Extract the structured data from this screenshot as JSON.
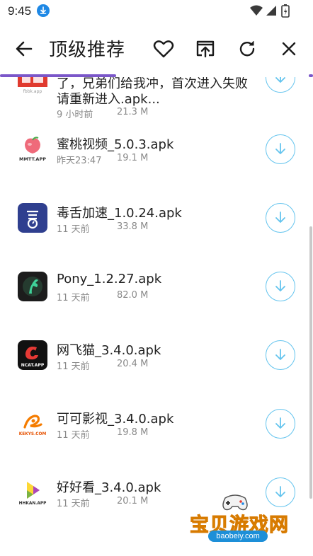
{
  "status_bar": {
    "time": "9:45"
  },
  "toolbar": {
    "title": "顶级推荐"
  },
  "progress": {
    "fraction": 0.37
  },
  "items": [
    {
      "name_line1": "了，兄弟们给我冲，首次进入失败",
      "name_line2": "请重新进入.apk...",
      "time": "9 小时前",
      "size": "21.3 M",
      "icon": "app-logo-banner-icon",
      "icon_text": "fbbk.app"
    },
    {
      "name": "蜜桃视频_5.0.3.apk",
      "time": "昨天23:47",
      "size": "19.1 M",
      "icon": "peach-logo-icon",
      "icon_text": "MMTT.APP"
    },
    {
      "name": "毒舌加速_1.0.24.apk",
      "time": "11 天前",
      "size": "33.8 M",
      "icon": "accelerator-logo-icon"
    },
    {
      "name": "Pony_1.2.27.apk",
      "time": "11 天前",
      "size": "82.0 M",
      "icon": "pony-logo-icon"
    },
    {
      "name": "网飞猫_3.4.0.apk",
      "time": "11 天前",
      "size": "20.4 M",
      "icon": "ncat-logo-icon",
      "icon_text": "NCAT.APP"
    },
    {
      "name": "可可影视_3.4.0.apk",
      "time": "11 天前",
      "size": "19.8 M",
      "icon": "kekys-logo-icon",
      "icon_text": "KEKYS.COM"
    },
    {
      "name": "好好看_3.4.0.apk",
      "time": "11 天前",
      "size": "20.1 M",
      "icon": "hhkan-logo-icon",
      "icon_text": "HHKAN.APP"
    }
  ],
  "watermark": {
    "name": "宝贝游戏网",
    "url": "baobeiy.com"
  },
  "colors": {
    "accent": "#7b57c9",
    "download_ring": "#64c4ee",
    "text_primary": "#222222",
    "text_secondary": "#8a8a8a"
  }
}
